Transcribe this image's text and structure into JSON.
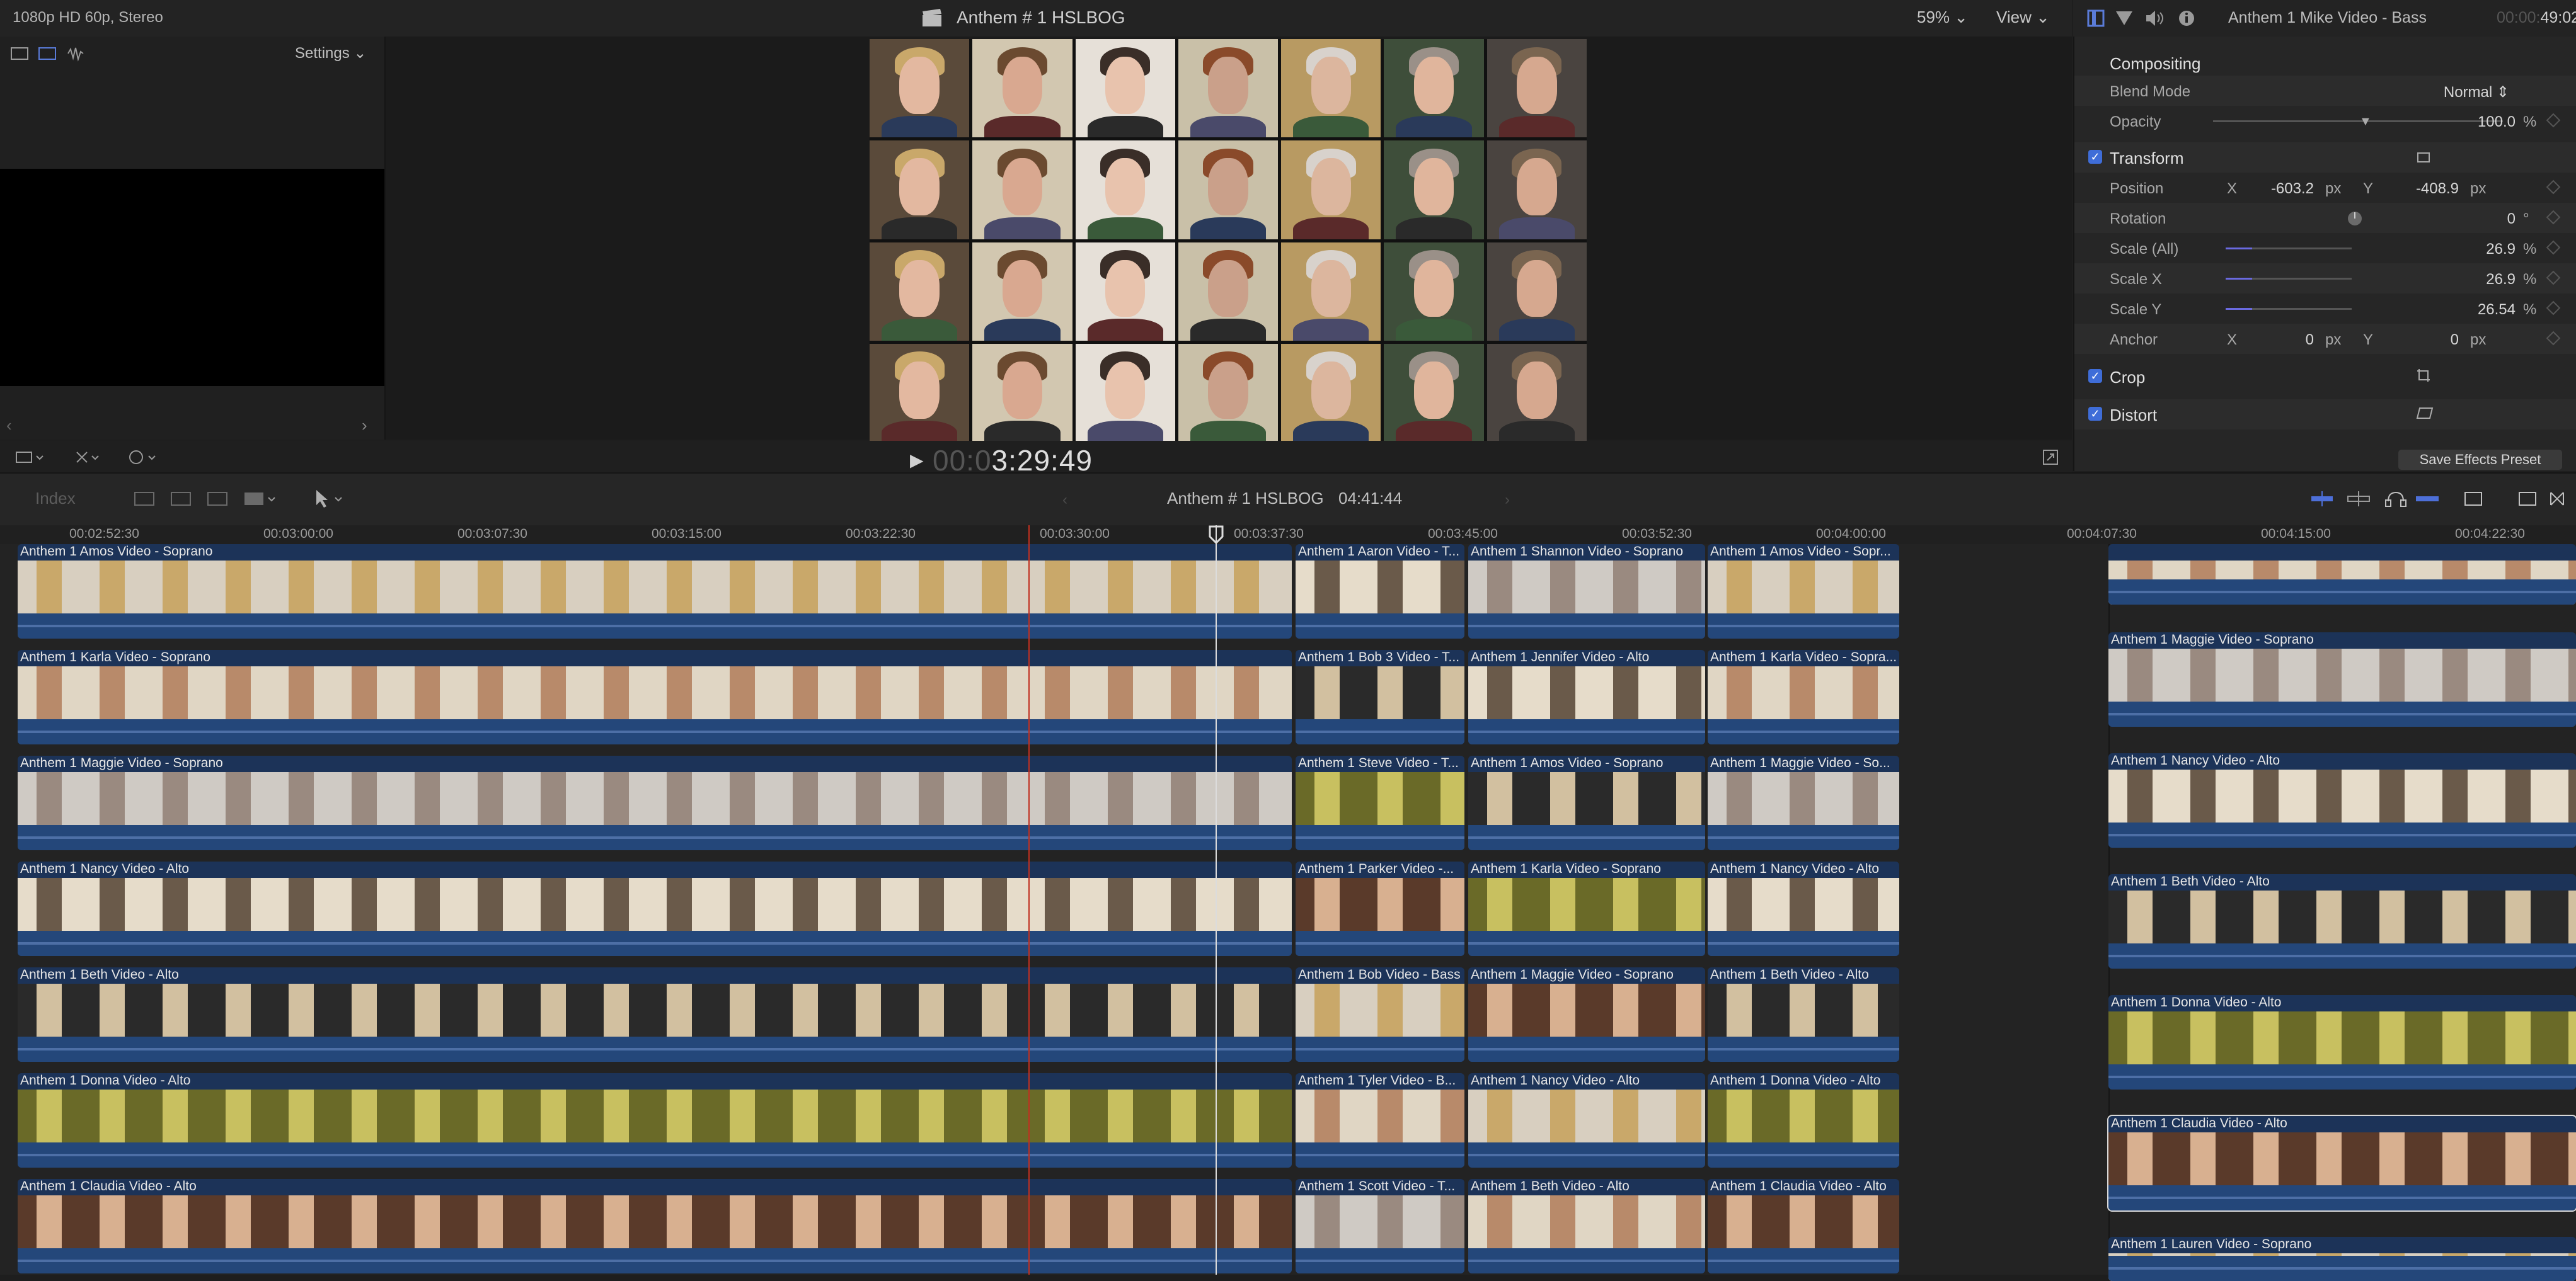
{
  "topbar": {
    "format_info": "1080p HD 60p, Stereo",
    "project_title": "Anthem # 1 HSLBOG",
    "zoom": "59%",
    "view": "View"
  },
  "browser": {
    "settings": "Settings"
  },
  "viewer": {
    "timecode_dim": "00:0",
    "timecode_lit": "3:29:49"
  },
  "inspector": {
    "clip_name": "Anthem 1 Mike Video - Bass",
    "duration_dim": "00:00:",
    "duration_lit": "49:02",
    "compositing": "Compositing",
    "blend_mode_label": "Blend Mode",
    "blend_mode_value": "Normal",
    "opacity_label": "Opacity",
    "opacity_value": "100.0",
    "opacity_unit": "%",
    "transform": "Transform",
    "position_label": "Position",
    "position_x_label": "X",
    "position_x": "-603.2",
    "position_y_label": "Y",
    "position_y": "-408.9",
    "px": "px",
    "rotation_label": "Rotation",
    "rotation_value": "0",
    "degree": "°",
    "scale_all_label": "Scale (All)",
    "scale_all": "26.9",
    "scale_x_label": "Scale X",
    "scale_x": "26.9",
    "scale_y_label": "Scale Y",
    "scale_y": "26.54",
    "percent": "%",
    "anchor_label": "Anchor",
    "anchor_x_label": "X",
    "anchor_x": "0",
    "anchor_y_label": "Y",
    "anchor_y": "0",
    "crop": "Crop",
    "distort": "Distort",
    "save_preset": "Save Effects Preset"
  },
  "timeline_toolbar": {
    "index": "Index",
    "project": "Anthem # 1 HSLBOG",
    "duration": "04:41:44"
  },
  "ruler": [
    "00:02:52:30",
    "00:03:00:00",
    "00:03:07:30",
    "00:03:15:00",
    "00:03:22:30",
    "00:03:30:00",
    "00:03:37:30",
    "00:03:45:00",
    "00:03:52:30",
    "00:04:00:00",
    "00:04:07:30",
    "00:04:15:00",
    "00:04:22:30"
  ],
  "lanes_left": [
    "Anthem 1 Amos Video - Soprano",
    "Anthem 1 Karla Video - Soprano",
    "Anthem 1 Maggie Video - Soprano",
    "Anthem 1 Nancy Video - Alto",
    "Anthem 1 Beth Video - Alto",
    "Anthem 1 Donna Video - Alto",
    "Anthem 1 Claudia Video - Alto"
  ],
  "lanes_mid_a": [
    "Anthem 1 Aaron Video - T...",
    "Anthem 1 Bob 3 Video - T...",
    "Anthem 1 Steve Video - T...",
    "Anthem 1 Parker Video -...",
    "Anthem 1 Bob Video - Bass",
    "Anthem 1 Tyler Video - B...",
    "Anthem 1 Scott Video - T..."
  ],
  "lanes_mid_b": [
    "Anthem 1 Shannon Video - Soprano",
    "Anthem 1 Jennifer Video - Alto",
    "Anthem 1 Amos Video - Soprano",
    "Anthem 1 Karla Video - Soprano",
    "Anthem 1 Maggie Video - Soprano",
    "Anthem 1 Nancy Video - Alto",
    "Anthem 1 Beth Video - Alto"
  ],
  "lanes_mid_c": [
    "Anthem 1 Amos Video - Sopr...",
    "Anthem 1 Karla Video - Sopra...",
    "Anthem 1 Maggie Video - So...",
    "Anthem 1 Nancy Video - Alto",
    "Anthem 1 Beth Video - Alto",
    "Anthem 1 Donna Video - Alto",
    "Anthem 1 Claudia Video - Alto"
  ],
  "lanes_right": [
    "",
    "Anthem 1 Maggie Video - Soprano",
    "Anthem 1 Nancy Video - Alto",
    "Anthem 1 Beth Video - Alto",
    "Anthem 1 Donna Video - Alto",
    "Anthem 1 Claudia Video - Alto",
    "Anthem 1 Lauren Video - Soprano"
  ],
  "colors": {
    "accent": "#3f6dd8",
    "clip_bg": "#1c3358",
    "playhead_skimmer": "#c03020"
  }
}
